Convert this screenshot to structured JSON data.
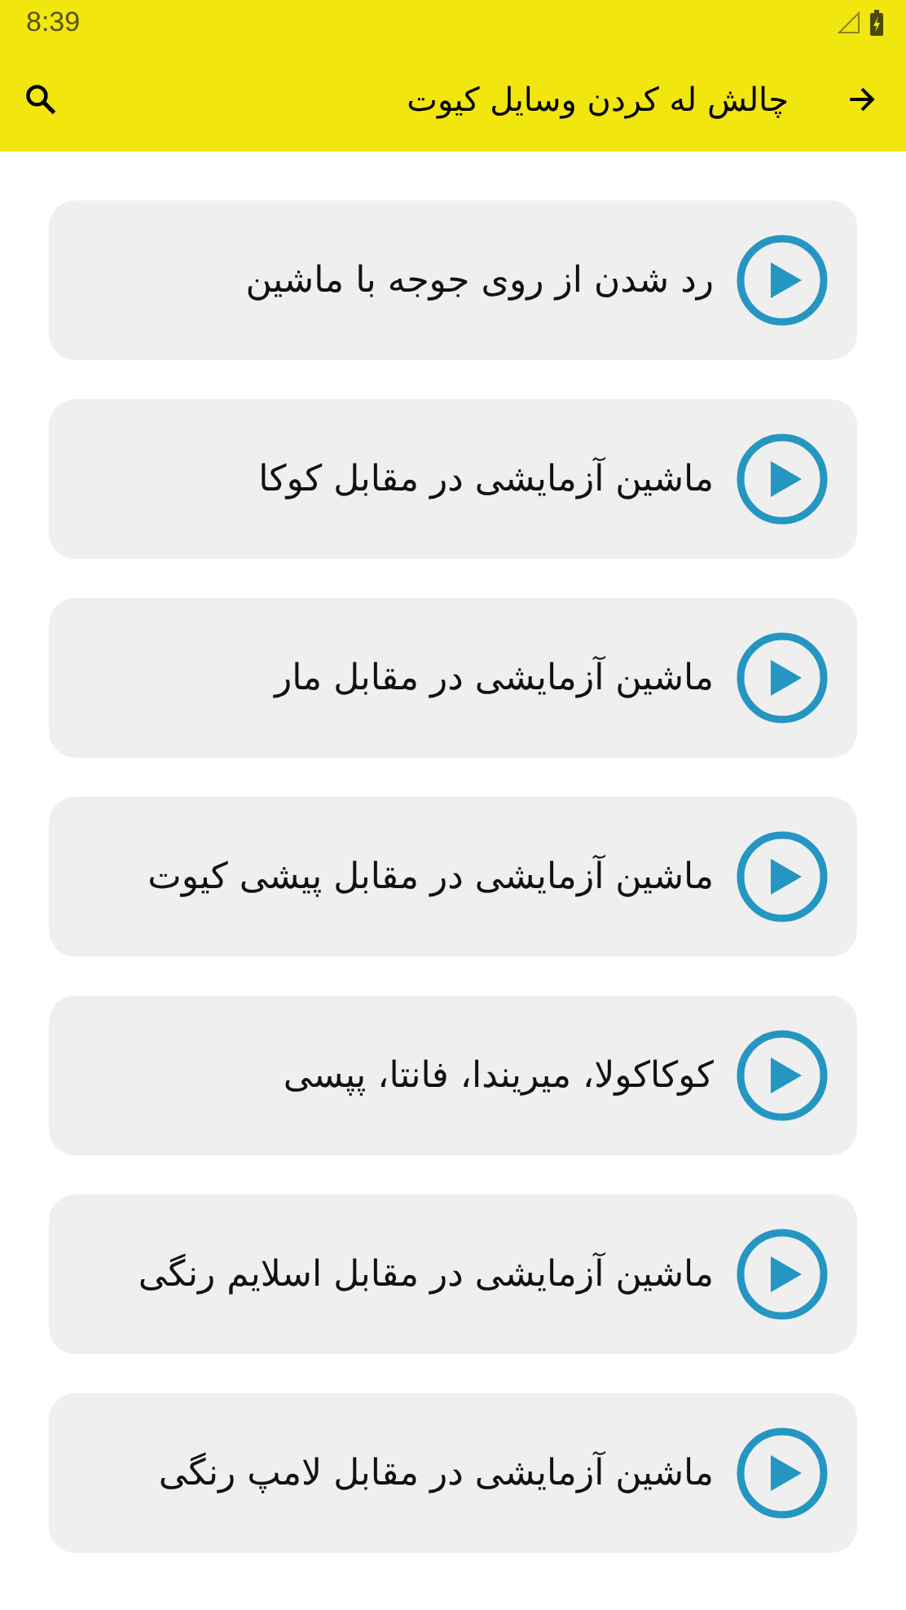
{
  "status_bar": {
    "time": "8:39"
  },
  "app_bar": {
    "title": "چالش له کردن وسایل کیوت"
  },
  "videos": [
    {
      "title": "رد شدن از روی جوجه با ماشین"
    },
    {
      "title": "ماشین آزمایشی در مقابل کوکا"
    },
    {
      "title": "ماشین آزمایشی در مقابل مار"
    },
    {
      "title": "ماشین آزمایشی در مقابل پیشی کیوت"
    },
    {
      "title": "کوکاکولا، میریندا، فانتا، پپسی"
    },
    {
      "title": "ماشین آزمایشی در مقابل اسلایم رنگی"
    },
    {
      "title": "ماشین آزمایشی در مقابل لامپ رنگی"
    }
  ]
}
